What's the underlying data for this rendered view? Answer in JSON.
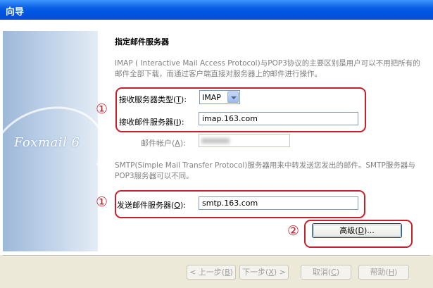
{
  "window": {
    "title": "向导"
  },
  "sidebar": {
    "brand_text": "Foxmail 6"
  },
  "page": {
    "heading": "指定邮件服务器",
    "desc_imap": "IMAP ( Interactive Mail Access Protocol)与POP3协议的主要区别是用户可以不用把所有的邮件全部下载，而通过客户端直接对服务器上的邮件进行操作。",
    "desc_smtp": "SMTP(Simple Mail Transfer Protocol)服务器用来中转发送您发出的邮件。SMTP服务器与POP3服务器可以不同。"
  },
  "annotations": {
    "marker1": "①",
    "marker2": "②"
  },
  "fields": {
    "server_type": {
      "label": "接收服务器类型(",
      "key": "T",
      "label_end": "):",
      "value": "IMAP"
    },
    "incoming": {
      "label": "接收邮件服务器(",
      "key": "I",
      "label_end": "):",
      "value": "imap.163.com"
    },
    "account": {
      "label": "邮件帐户(",
      "key": "A",
      "label_end": "):"
    },
    "outgoing": {
      "label": "发送邮件服务器(",
      "key": "O",
      "label_end": "):",
      "value": "smtp.163.com"
    }
  },
  "buttons": {
    "advanced": {
      "label": "高级(",
      "key": "D",
      "label_end": ")..."
    },
    "back": {
      "label": "< 上一步(",
      "key": "B",
      "label_end": ")"
    },
    "next": {
      "label": "下一步(",
      "key": "X",
      "label_end": ") >"
    },
    "cancel": {
      "label": "取消(",
      "key": "C",
      "label_end": ")"
    },
    "help": {
      "label": "帮助(",
      "key": "H",
      "label_end": ")"
    }
  },
  "colors": {
    "annotation_red": "#C8202A",
    "titlebar_blue": "#0055E5"
  }
}
